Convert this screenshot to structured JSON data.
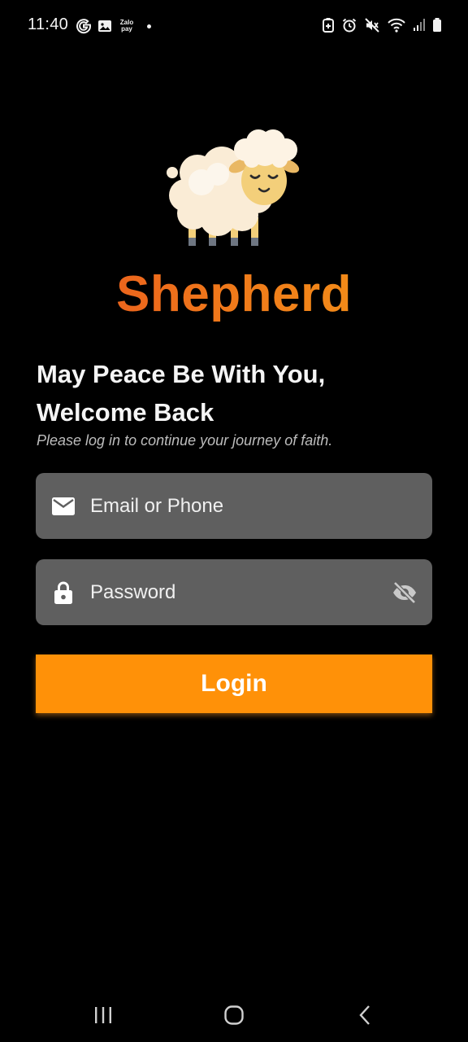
{
  "status_bar": {
    "time": "11:40",
    "left_icons": [
      "google-icon",
      "gallery-icon",
      "zalo-pay-icon",
      "notification-dot"
    ],
    "zalo_line1": "Zalo",
    "zalo_line2": "pay",
    "right_icons": [
      "battery-saver-icon",
      "alarm-icon",
      "mute-icon",
      "wifi-icon",
      "signal-icon",
      "battery-icon"
    ]
  },
  "app": {
    "logo_icon": "sheep-icon",
    "name": "Shepherd"
  },
  "greeting": {
    "line1": "May Peace Be With You,",
    "line2": "Welcome Back",
    "subtitle": "Please log in to continue your journey of faith."
  },
  "form": {
    "email": {
      "icon": "mail-icon",
      "placeholder": "Email or Phone",
      "value": ""
    },
    "password": {
      "icon": "lock-icon",
      "placeholder": "Password",
      "value": "",
      "toggle_icon": "eye-off-icon"
    },
    "login_label": "Login"
  },
  "nav_bar": {
    "buttons": [
      "recents-icon",
      "home-icon",
      "back-icon"
    ]
  },
  "colors": {
    "background": "#000000",
    "field_bg": "#5f5f5f",
    "accent": "#ff9108",
    "brand_gradient_start": "#e8501e",
    "brand_gradient_end": "#f59a17"
  }
}
